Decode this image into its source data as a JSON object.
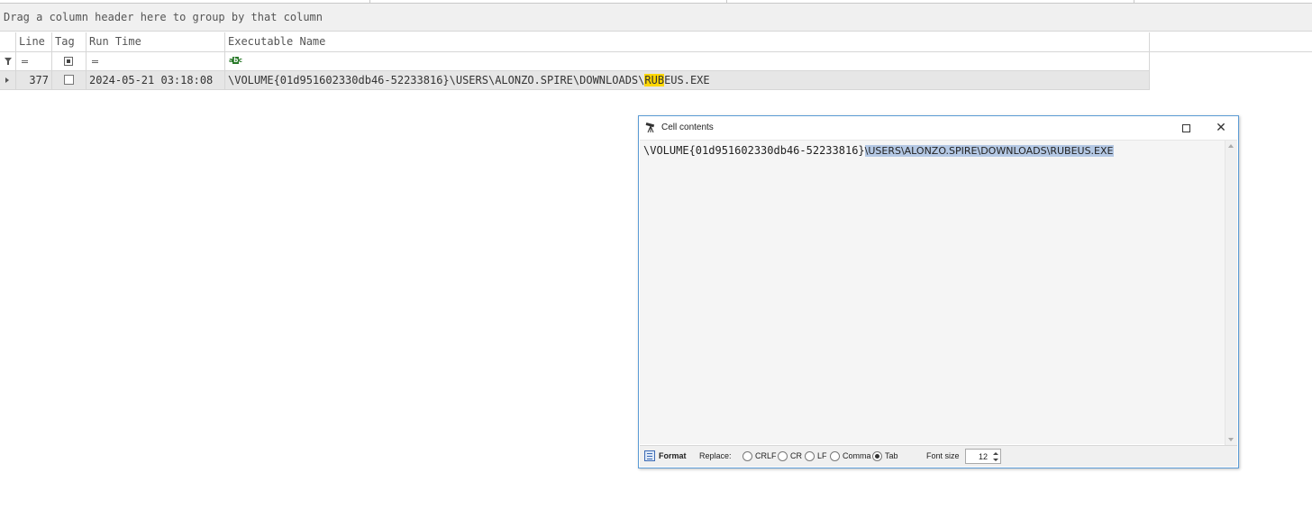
{
  "group_panel": {
    "text": "Drag a column header here to group by that column"
  },
  "columns": [
    {
      "label": "Line"
    },
    {
      "label": "Tag"
    },
    {
      "label": "Run Time"
    },
    {
      "label": "Executable Name"
    }
  ],
  "filter_row": {
    "abc_icon": "abc-filter-icon"
  },
  "rows": [
    {
      "line": "377",
      "tag_checked": false,
      "run_time": "2024-05-21 03:18:08",
      "exe_prefix": "\\VOLUME{01d951602330db46-52233816}\\USERS\\ALONZO.SPIRE\\DOWNLOADS\\",
      "exe_highlight": "RUB",
      "exe_suffix": "EUS.EXE"
    }
  ],
  "dialog": {
    "title": "Cell contents",
    "content_plain": "\\VOLUME{01d951602330db46-52233816}",
    "content_selected": "\\USERS\\ALONZO.SPIRE\\DOWNLOADS\\RUBEUS.EXE",
    "format_label": "Format",
    "replace_label": "Replace:",
    "replace_options": [
      {
        "label": "CRLF",
        "selected": false
      },
      {
        "label": "CR",
        "selected": false
      },
      {
        "label": "LF",
        "selected": false
      },
      {
        "label": "Comma",
        "selected": false
      },
      {
        "label": "Tab",
        "selected": true
      }
    ],
    "font_size_label": "Font size",
    "font_size_value": "12"
  },
  "colors": {
    "highlight": "#ffd700",
    "selection": "#b4c8e4",
    "dialog_border": "#5b9bd5"
  }
}
